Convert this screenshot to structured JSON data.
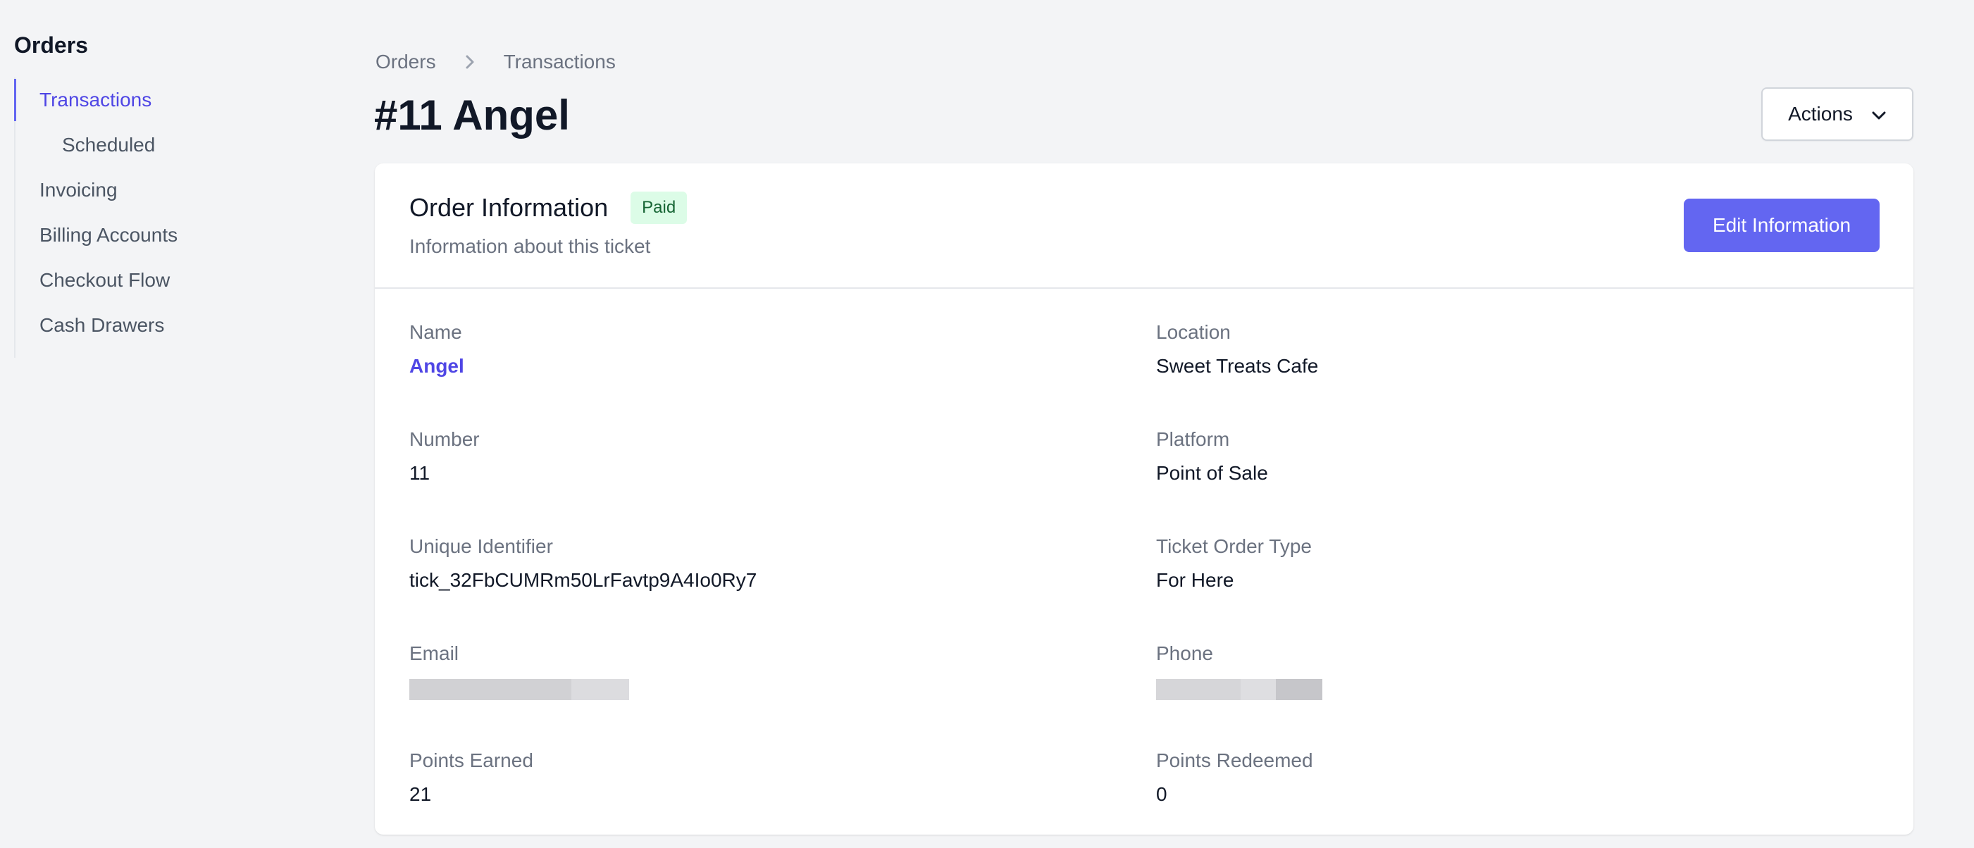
{
  "sidebar": {
    "title": "Orders",
    "items": [
      {
        "label": "Transactions",
        "active": true
      },
      {
        "label": "Scheduled",
        "sub": true
      },
      {
        "label": "Invoicing"
      },
      {
        "label": "Billing Accounts"
      },
      {
        "label": "Checkout Flow"
      },
      {
        "label": "Cash Drawers"
      }
    ]
  },
  "breadcrumb": {
    "items": [
      "Orders",
      "Transactions"
    ],
    "separator_icon": "chevron-right-icon"
  },
  "page": {
    "title": "#11 Angel",
    "actions_label": "Actions",
    "actions_icon": "chevron-down-icon"
  },
  "card": {
    "title": "Order Information",
    "status_badge": "Paid",
    "subtitle": "Information about this ticket",
    "edit_label": "Edit Information",
    "fields": {
      "name": {
        "label": "Name",
        "value": "Angel"
      },
      "location": {
        "label": "Location",
        "value": "Sweet Treats Cafe"
      },
      "number": {
        "label": "Number",
        "value": "11"
      },
      "platform": {
        "label": "Platform",
        "value": "Point of Sale"
      },
      "unique_identifier": {
        "label": "Unique Identifier",
        "value": "tick_32FbCUMRm50LrFavtp9A4Io0Ry7"
      },
      "ticket_order_type": {
        "label": "Ticket Order Type",
        "value": "For Here"
      },
      "email": {
        "label": "Email"
      },
      "phone": {
        "label": "Phone"
      },
      "points_earned": {
        "label": "Points Earned",
        "value": "21"
      },
      "points_redeemed": {
        "label": "Points Redeemed",
        "value": "0"
      }
    }
  },
  "colors": {
    "accent": "#6366f1",
    "link": "#4f46e5",
    "badge_bg": "#dcfce7",
    "badge_text": "#166534",
    "background": "#f3f4f6"
  }
}
